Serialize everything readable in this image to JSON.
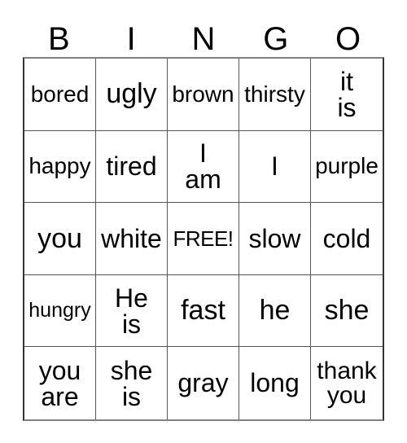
{
  "card": {
    "type": "bingo-card",
    "title": "BINGO",
    "columns": 5,
    "rows": 5,
    "free_space": {
      "row": 3,
      "column": 3,
      "label": "FREE!"
    },
    "colors": {
      "background": "#ffffff",
      "text": "#000000",
      "grid_line": "#555555",
      "outer_border": "#333333"
    }
  },
  "header": {
    "letters": [
      "B",
      "I",
      "N",
      "G",
      "O"
    ]
  },
  "rows": [
    {
      "index": 1,
      "cells": [
        {
          "text": "bored",
          "lines": [
            "bored"
          ],
          "size": "fs-sm"
        },
        {
          "text": "ugly",
          "lines": [
            "ugly"
          ],
          "size": "fs-xl"
        },
        {
          "text": "brown",
          "lines": [
            "brown"
          ],
          "size": "fs-sm"
        },
        {
          "text": "thirsty",
          "lines": [
            "thirsty"
          ],
          "size": "fs-sm"
        },
        {
          "text": "it\nis",
          "lines": [
            "it",
            "is"
          ],
          "size": "fs-lg"
        }
      ]
    },
    {
      "index": 2,
      "cells": [
        {
          "text": "happy",
          "lines": [
            "happy"
          ],
          "size": "fs-sm"
        },
        {
          "text": "tired",
          "lines": [
            "tired"
          ],
          "size": "fs-lg"
        },
        {
          "text": "I\nam",
          "lines": [
            "I",
            "am"
          ],
          "size": "fs-lg"
        },
        {
          "text": "I",
          "lines": [
            "I"
          ],
          "size": "fs-lg"
        },
        {
          "text": "purple",
          "lines": [
            "purple"
          ],
          "size": "fs-sm"
        }
      ]
    },
    {
      "index": 3,
      "cells": [
        {
          "text": "you",
          "lines": [
            "you"
          ],
          "size": "fs-xl"
        },
        {
          "text": "white",
          "lines": [
            "white"
          ],
          "size": "fs-lg"
        },
        {
          "text": "FREE!",
          "lines": [
            "FREE!"
          ],
          "size": "fs-free"
        },
        {
          "text": "slow",
          "lines": [
            "slow"
          ],
          "size": "fs-lg"
        },
        {
          "text": "cold",
          "lines": [
            "cold"
          ],
          "size": "fs-lg"
        }
      ]
    },
    {
      "index": 4,
      "cells": [
        {
          "text": "hungry",
          "lines": [
            "hungry"
          ],
          "size": "fs-xs"
        },
        {
          "text": "He\nis",
          "lines": [
            "He",
            "is"
          ],
          "size": "fs-lg"
        },
        {
          "text": "fast",
          "lines": [
            "fast"
          ],
          "size": "fs-xl"
        },
        {
          "text": "he",
          "lines": [
            "he"
          ],
          "size": "fs-xl"
        },
        {
          "text": "she",
          "lines": [
            "she"
          ],
          "size": "fs-xl"
        }
      ]
    },
    {
      "index": 5,
      "cells": [
        {
          "text": "you\nare",
          "lines": [
            "you",
            "are"
          ],
          "size": "fs-lg"
        },
        {
          "text": "she\nis",
          "lines": [
            "she",
            "is"
          ],
          "size": "fs-lg"
        },
        {
          "text": "gray",
          "lines": [
            "gray"
          ],
          "size": "fs-lg"
        },
        {
          "text": "long",
          "lines": [
            "long"
          ],
          "size": "fs-lg"
        },
        {
          "text": "thank\nyou",
          "lines": [
            "thank",
            "you"
          ],
          "size": "fs-md"
        }
      ]
    }
  ]
}
